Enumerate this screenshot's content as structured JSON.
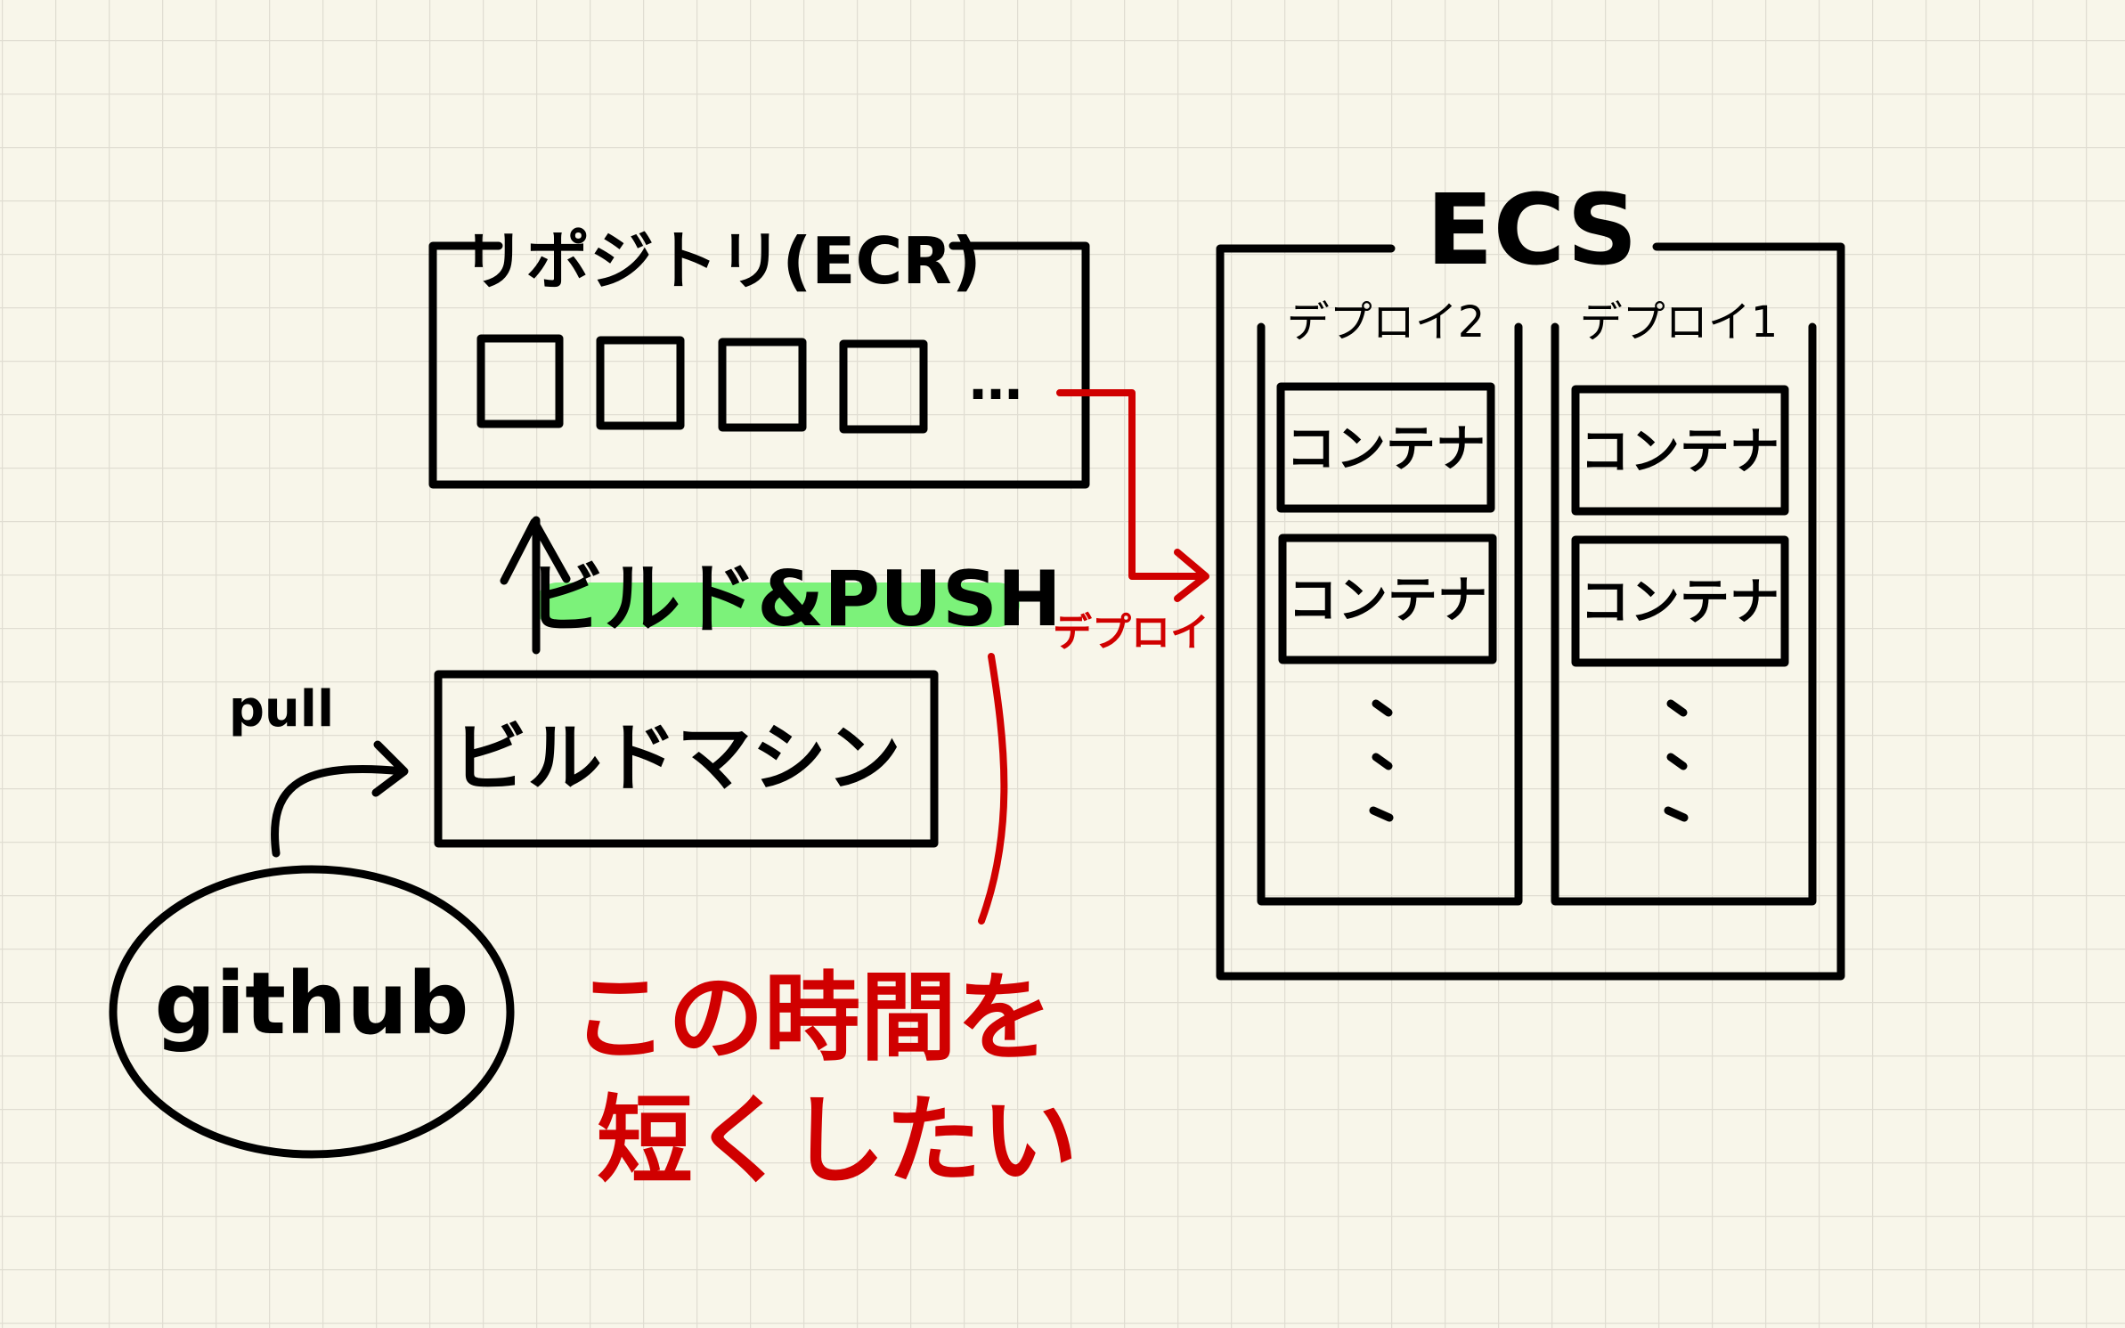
{
  "repository": {
    "title": "リポジトリ(ECR)",
    "ellipsis": "…"
  },
  "build_push": {
    "label": "ビルド&PUSH"
  },
  "build_machine": {
    "label": "ビルドマシン"
  },
  "pull": {
    "label": "pull"
  },
  "github": {
    "label": "github"
  },
  "deploy_arrow": {
    "label": "デプロイ"
  },
  "ecs": {
    "title": "ECS",
    "deployments": [
      {
        "label": "デプロイ2",
        "containers": [
          "コンテナ",
          "コンテナ"
        ]
      },
      {
        "label": "デプロイ1",
        "containers": [
          "コンテナ",
          "コンテナ"
        ]
      }
    ]
  },
  "note": {
    "line1": "この時間を",
    "line2": "短くしたい"
  },
  "colors": {
    "ink": "#000000",
    "accent_red": "#d00000",
    "highlight_green": "#7cf27a",
    "paper": "#f8f6ea",
    "grid": "#e0ddd2"
  }
}
